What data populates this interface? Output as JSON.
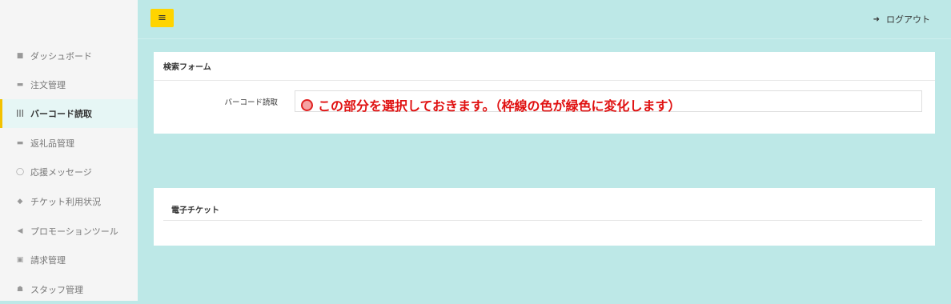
{
  "sidebar": {
    "items": [
      {
        "icon": "■",
        "label": "ダッシュボード",
        "active": false
      },
      {
        "icon": "▬",
        "label": "注文管理",
        "active": false
      },
      {
        "icon": "|||",
        "label": "バーコード読取",
        "active": true
      },
      {
        "icon": "▬",
        "label": "返礼品管理",
        "active": false
      },
      {
        "icon": "◯",
        "label": "応援メッセージ",
        "active": false
      },
      {
        "icon": "◆",
        "label": "チケット利用状況",
        "active": false
      },
      {
        "icon": "◀",
        "label": "プロモーションツール",
        "active": false
      },
      {
        "icon": "▣",
        "label": "請求管理",
        "active": false
      },
      {
        "icon": "☗",
        "label": "スタッフ管理",
        "active": false
      }
    ]
  },
  "header": {
    "menu_icon": "≡",
    "logout_icon": "➜",
    "logout_label": "ログアウト"
  },
  "search_form": {
    "title": "検索フォーム",
    "barcode_label": "バーコード読取",
    "barcode_value": ""
  },
  "annotation": {
    "text": "この部分を選択しておきます。（枠線の色が緑色に変化します）",
    "color": "#e01010"
  },
  "ticket_section": {
    "title": "電子チケット"
  },
  "colors": {
    "background": "#bde8e7",
    "accent": "#ffd400"
  }
}
